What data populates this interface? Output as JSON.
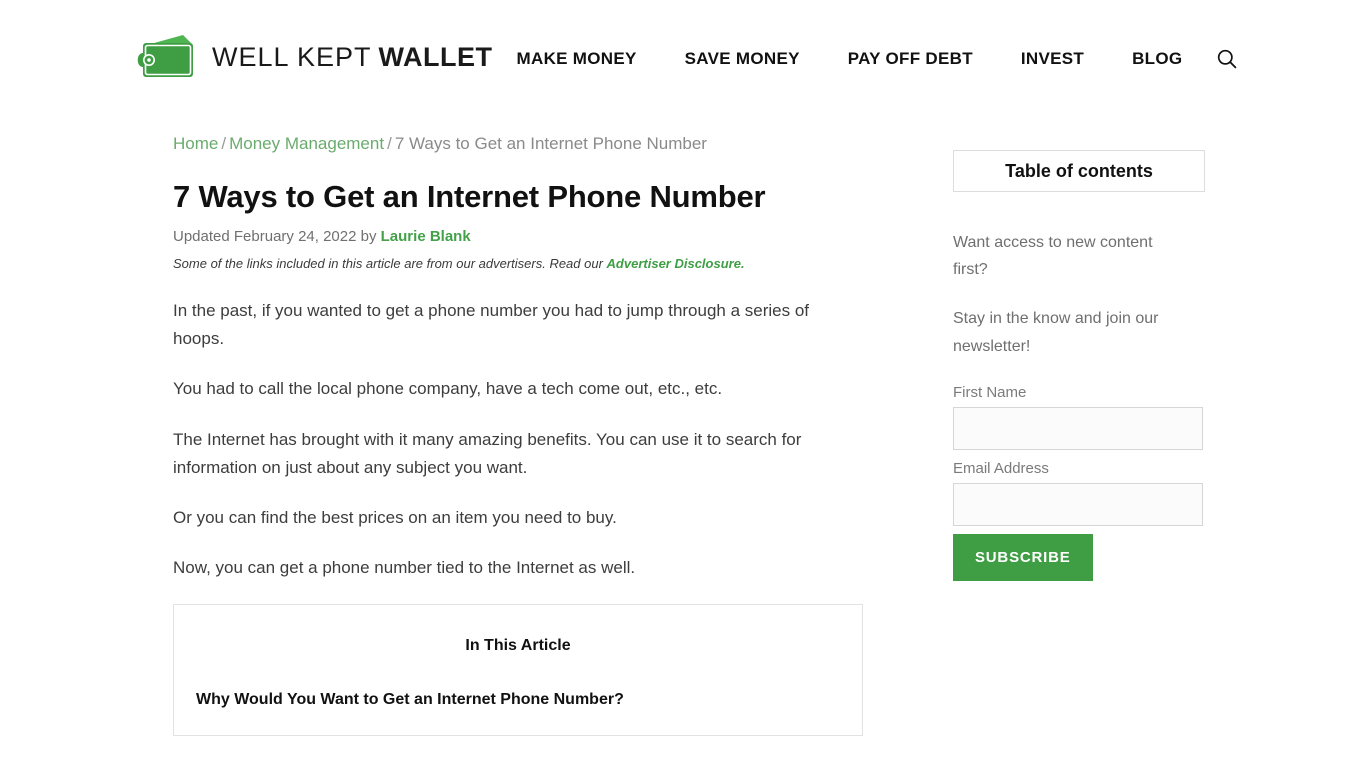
{
  "header": {
    "logo": {
      "icon": "wallet-icon",
      "text_light": "WELL KEPT",
      "text_bold": "WALLET",
      "color": "#44a147"
    },
    "nav": [
      {
        "label": "MAKE MONEY",
        "name": "nav-item-make-money"
      },
      {
        "label": "SAVE MONEY",
        "name": "nav-item-save-money"
      },
      {
        "label": "PAY OFF DEBT",
        "name": "nav-item-pay-off-debt"
      },
      {
        "label": "INVEST",
        "name": "nav-item-invest"
      },
      {
        "label": "BLOG",
        "name": "nav-item-blog"
      }
    ],
    "search_icon": "search-icon"
  },
  "breadcrumb": {
    "home": "Home",
    "sep1": "/",
    "category": "Money Management",
    "sep2": "/",
    "current": "7 Ways to Get an Internet Phone Number"
  },
  "article": {
    "title": "7 Ways to Get an Internet Phone Number",
    "byline_prefix": "Updated February 24, 2022 by ",
    "byline_author": "Laurie Blank",
    "disclosure_text": "Some of the links included in this article are from our advertisers. Read our ",
    "disclosure_link": "Advertiser Disclosure.",
    "paragraphs": [
      "In the past, if you wanted to get a phone number you had to jump through a series of hoops.",
      "You had to call the local phone company, have a tech come out, etc., etc.",
      "The Internet has brought with it many amazing benefits. You can use it to search for information on just about any subject you want.",
      "Or you can find the best prices on an item you need to buy.",
      "Now, you can get a phone number tied to the Internet as well."
    ],
    "in_this_article": {
      "heading": "In This Article",
      "items": [
        "Why Would You Want to Get an Internet Phone Number?"
      ]
    }
  },
  "sidebar": {
    "toc_label": "Table of contents",
    "newsletter": {
      "line1": "Want access to new content first?",
      "line2": "Stay in the know and join our newsletter!",
      "first_name_label": "First Name",
      "first_name_value": "",
      "email_label": "Email Address",
      "email_value": "",
      "subscribe_label": "SUBSCRIBE",
      "subscribe_color": "#3f9e44"
    }
  }
}
